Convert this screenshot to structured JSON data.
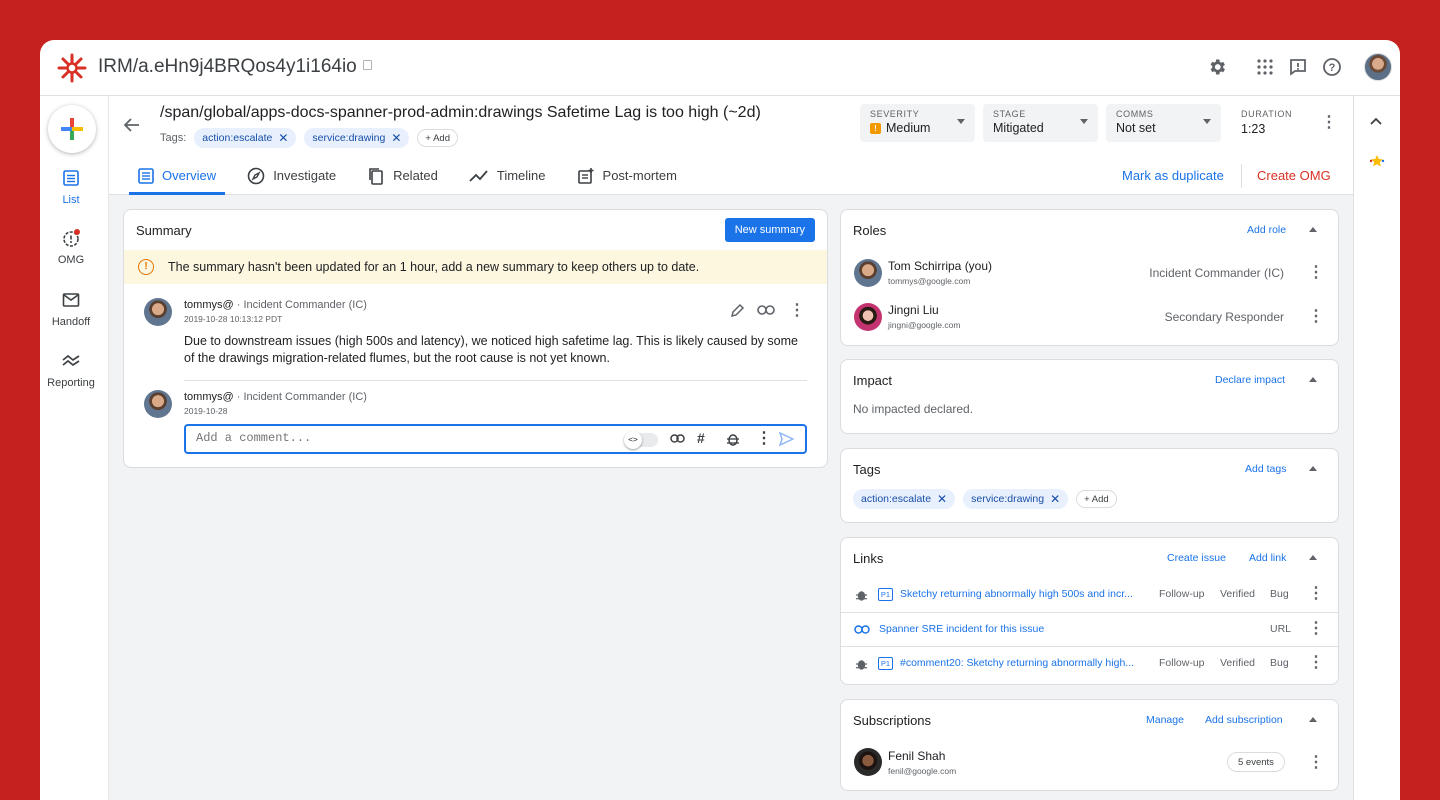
{
  "app": {
    "title": "IRM/a.eHn9j4BRQos4y1i164io"
  },
  "nav": {
    "list": "List",
    "omg": "OMG",
    "handoff": "Handoff",
    "reporting": "Reporting"
  },
  "incident": {
    "title": "/span/global/apps-docs-spanner-prod-admin:drawings Safetime Lag is too high (~2d)",
    "tags_label": "Tags:",
    "tags": [
      "action:escalate",
      "service:drawing"
    ],
    "add_label": "+ Add",
    "severity": {
      "label": "SEVERITY",
      "value": "Medium",
      "icon": "!"
    },
    "stage": {
      "label": "STAGE",
      "value": "Mitigated"
    },
    "comms": {
      "label": "COMMS",
      "value": "Not set"
    },
    "duration": {
      "label": "DURATION",
      "value": "1:23"
    }
  },
  "tabs": [
    "Overview",
    "Investigate",
    "Related",
    "Timeline",
    "Post-mortem"
  ],
  "header_actions": {
    "duplicate": "Mark as duplicate",
    "create_omg": "Create OMG"
  },
  "summary": {
    "title": "Summary",
    "new_button": "New summary",
    "warning": "The summary hasn't been updated for an 1 hour, add a new summary to keep others up to date.",
    "entry": {
      "user": "tommys@",
      "role": " · Incident Commander (IC)",
      "time": "2019-10-28 10:13:12 PDT",
      "text": "Due to downstream issues (high 500s and latency), we noticed high safetime lag. This is likely caused by some of the drawings migration-related flumes, but the root cause is not yet known."
    },
    "composer": {
      "user": "tommys@",
      "role": " · Incident Commander (IC)",
      "time": "2019-10-28",
      "placeholder": "Add a comment...",
      "code_toggle": "<>"
    }
  },
  "roles": {
    "title": "Roles",
    "add": "Add role",
    "items": [
      {
        "name": "Tom Schirripa (you)",
        "email": "tommys@google.com",
        "role": "Incident Commander (IC)"
      },
      {
        "name": "Jingni Liu",
        "email": "jingni@google.com",
        "role": "Secondary Responder"
      }
    ]
  },
  "impact": {
    "title": "Impact",
    "action": "Declare impact",
    "empty": "No impacted declared."
  },
  "tags_card": {
    "title": "Tags",
    "action": "Add tags",
    "tags": [
      "action:escalate",
      "service:drawing"
    ],
    "add_label": "+ Add"
  },
  "links": {
    "title": "Links",
    "create": "Create issue",
    "add": "Add link",
    "items": [
      {
        "priority": "P1",
        "text": "Sketchy returning abnormally high 500s and incr...",
        "relation": "Follow-up",
        "status": "Verified",
        "type": "Bug"
      },
      {
        "priority": "",
        "text": "Spanner SRE incident for this issue",
        "relation": "",
        "status": "",
        "type": "URL"
      },
      {
        "priority": "P1",
        "text": "#comment20: Sketchy returning abnormally high...",
        "relation": "Follow-up",
        "status": "Verified",
        "type": "Bug"
      }
    ]
  },
  "subscriptions": {
    "title": "Subscriptions",
    "manage": "Manage",
    "add": "Add subscription",
    "items": [
      {
        "name": "Fenil Shah",
        "email": "fenil@google.com",
        "events": "5 events"
      }
    ]
  },
  "colors": {
    "brand": "#c5221f",
    "accent": "#1a73e8",
    "danger": "#d93025",
    "warning": "#f29900"
  }
}
